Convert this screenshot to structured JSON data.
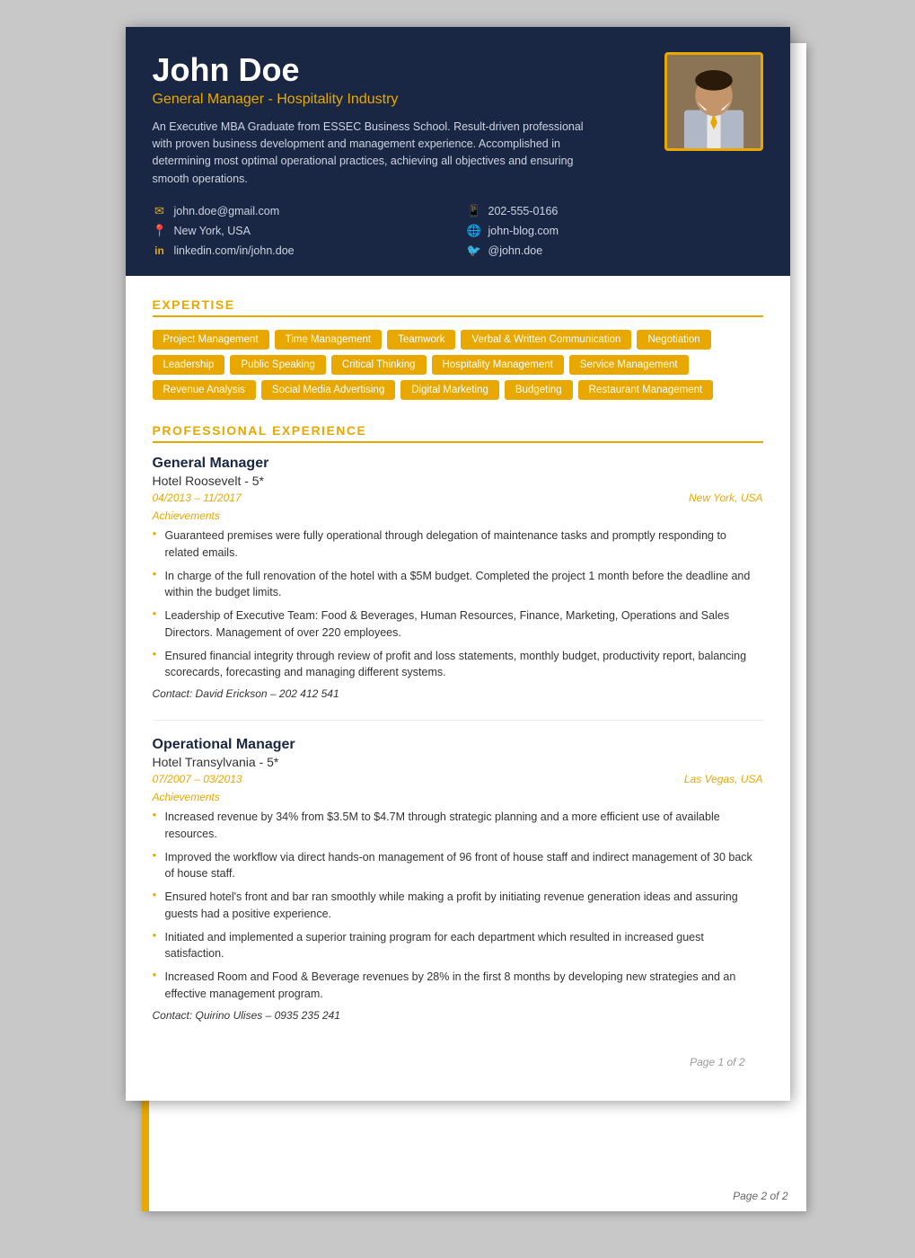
{
  "header": {
    "name": "John Doe",
    "title": "General Manager - Hospitality Industry",
    "summary": "An Executive MBA Graduate from ESSEC Business School. Result-driven professional with proven business development and management experience. Accomplished in determining most optimal operational practices, achieving all objectives and ensuring smooth operations.",
    "contact": [
      {
        "icon": "✉",
        "text": "john.doe@gmail.com",
        "col": 1
      },
      {
        "icon": "📱",
        "text": "202-555-0166",
        "col": 2
      },
      {
        "icon": "📍",
        "text": "New York, USA",
        "col": 1
      },
      {
        "icon": "🌐",
        "text": "john-blog.com",
        "col": 2
      },
      {
        "icon": "in",
        "text": "linkedin.com/in/john.doe",
        "col": 1
      },
      {
        "icon": "🐦",
        "text": "@john.doe",
        "col": 2
      }
    ]
  },
  "expertise": {
    "section_title": "EXPERTISE",
    "tags": [
      "Project Management",
      "Time Management",
      "Teamwork",
      "Verbal & Written Communication",
      "Negotiation",
      "Leadership",
      "Public Speaking",
      "Critical Thinking",
      "Hospitality Management",
      "Service Management",
      "Revenue Analysis",
      "Social Media Advertising",
      "Digital Marketing",
      "Budgeting",
      "Restaurant Management"
    ]
  },
  "experience": {
    "section_title": "PROFESSIONAL EXPERIENCE",
    "jobs": [
      {
        "title": "General Manager",
        "company": "Hotel Roosevelt - 5*",
        "dates": "04/2013 – 11/2017",
        "location": "New York, USA",
        "achievements_label": "Achievements",
        "achievements": [
          "Guaranteed premises were fully operational through delegation of maintenance tasks and promptly responding to related emails.",
          "In charge of the full renovation of the hotel with a $5M budget. Completed the project 1 month before the deadline and within the budget limits.",
          "Leadership of Executive Team: Food & Beverages, Human Resources, Finance, Marketing, Operations and Sales Directors. Management of over 220 employees.",
          "Ensured financial integrity through review of profit and loss statements, monthly budget, productivity report, balancing scorecards, forecasting and managing different systems."
        ],
        "contact_label": "Contact:",
        "contact": "David Erickson – 202 412 541"
      },
      {
        "title": "Operational Manager",
        "company": "Hotel Transylvania - 5*",
        "dates": "07/2007 – 03/2013",
        "location": "Las Vegas, USA",
        "achievements_label": "Achievements",
        "achievements": [
          "Increased revenue by 34% from $3.5M to $4.7M through strategic planning and a more efficient use of available resources.",
          "Improved the workflow via direct hands-on management of 96 front of house staff and indirect management of 30 back of house staff.",
          "Ensured hotel's front and bar ran smoothly while making a profit by initiating revenue generation ideas and assuring guests had a positive experience.",
          "Initiated and implemented a superior training program for each department which resulted in increased guest satisfaction.",
          "Increased Room and Food & Beverage revenues by 28% in the first 8 months by developing new strategies and an effective management program."
        ],
        "contact_label": "Contact:",
        "contact": "Quirino Ulises – 0935 235 241"
      }
    ]
  },
  "pagination": {
    "page1": "Page 1 of 2",
    "page2": "Page 2 of 2"
  }
}
